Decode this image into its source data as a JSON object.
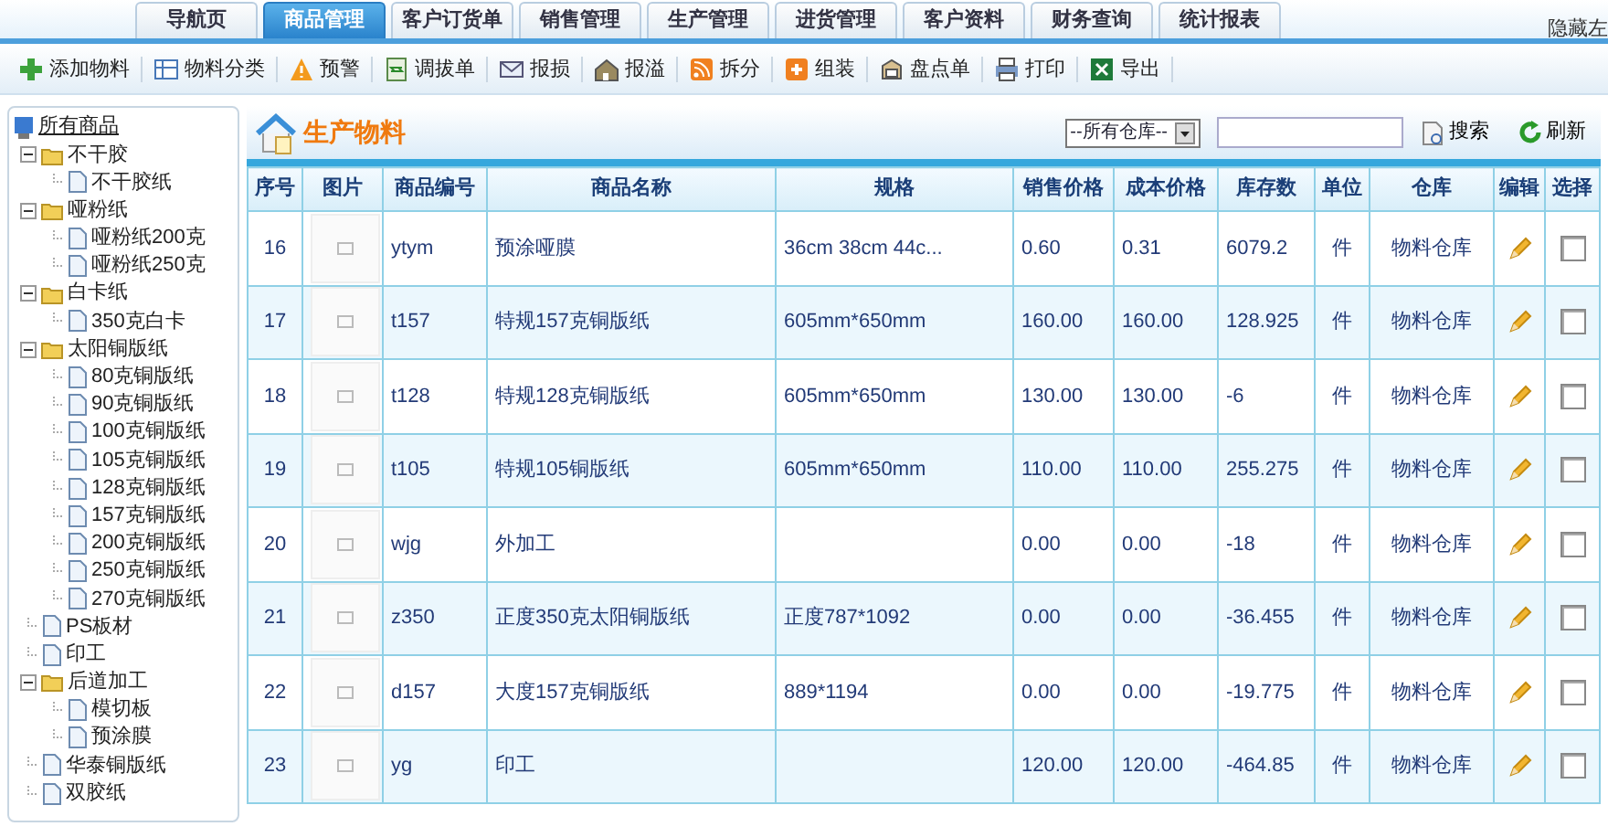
{
  "top_tabs": [
    {
      "label": "导航页",
      "selected": false
    },
    {
      "label": "商品管理",
      "selected": true
    },
    {
      "label": "客户订货单",
      "selected": false
    },
    {
      "label": "销售管理",
      "selected": false
    },
    {
      "label": "生产管理",
      "selected": false
    },
    {
      "label": "进货管理",
      "selected": false
    },
    {
      "label": "客户资料",
      "selected": false
    },
    {
      "label": "财务查询",
      "selected": false
    },
    {
      "label": "统计报表",
      "selected": false
    }
  ],
  "hide_left": "隐藏左",
  "toolbar": [
    "添加物料",
    "物料分类",
    "预警",
    "调拔单",
    "报损",
    "报溢",
    "拆分",
    "组装",
    "盘点单",
    "打印",
    "导出"
  ],
  "tree": {
    "root": "所有商品",
    "items": [
      {
        "label": "不干胶",
        "kind": "folder",
        "expanded": true,
        "children": [
          {
            "label": "不干胶纸",
            "kind": "leaf"
          }
        ]
      },
      {
        "label": "哑粉纸",
        "kind": "folder",
        "expanded": true,
        "children": [
          {
            "label": "哑粉纸200克",
            "kind": "leaf"
          },
          {
            "label": "哑粉纸250克",
            "kind": "leaf"
          }
        ]
      },
      {
        "label": "白卡纸",
        "kind": "folder",
        "expanded": true,
        "children": [
          {
            "label": "350克白卡",
            "kind": "leaf"
          }
        ]
      },
      {
        "label": "太阳铜版纸",
        "kind": "folder",
        "expanded": true,
        "children": [
          {
            "label": "80克铜版纸",
            "kind": "leaf"
          },
          {
            "label": "90克铜版纸",
            "kind": "leaf"
          },
          {
            "label": "100克铜版纸",
            "kind": "leaf"
          },
          {
            "label": "105克铜版纸",
            "kind": "leaf"
          },
          {
            "label": "128克铜版纸",
            "kind": "leaf"
          },
          {
            "label": "157克铜版纸",
            "kind": "leaf"
          },
          {
            "label": "200克铜版纸",
            "kind": "leaf"
          },
          {
            "label": "250克铜版纸",
            "kind": "leaf"
          },
          {
            "label": "270克铜版纸",
            "kind": "leaf"
          }
        ]
      },
      {
        "label": "PS板材",
        "kind": "leaf"
      },
      {
        "label": "印工",
        "kind": "leaf"
      },
      {
        "label": "后道加工",
        "kind": "folder",
        "expanded": true,
        "children": [
          {
            "label": "模切板",
            "kind": "leaf"
          },
          {
            "label": "预涂膜",
            "kind": "leaf"
          }
        ]
      },
      {
        "label": "华泰铜版纸",
        "kind": "leaf"
      },
      {
        "label": "双胶纸",
        "kind": "leaf"
      }
    ]
  },
  "panel": {
    "title": "生产物料",
    "warehouse_select": "--所有仓库--",
    "search_button": "搜索",
    "refresh_button": "刷新"
  },
  "table": {
    "columns": [
      "序号",
      "图片",
      "商品编号",
      "商品名称",
      "规格",
      "销售价格",
      "成本价格",
      "库存数",
      "单位",
      "仓库",
      "编辑",
      "选择"
    ],
    "rows": [
      {
        "no": "16",
        "code": "ytym",
        "name": "预涂哑膜",
        "spec": "36cm 38cm 44c...",
        "sale": "0.60",
        "cost": "0.31",
        "stock": "6079.2",
        "unit": "件",
        "warehouse": "物料仓库",
        "checked": false
      },
      {
        "no": "17",
        "code": "t157",
        "name": "特规157克铜版纸",
        "spec": "605mm*650mm",
        "sale": "160.00",
        "cost": "160.00",
        "stock": "128.925",
        "unit": "件",
        "warehouse": "物料仓库",
        "checked": false
      },
      {
        "no": "18",
        "code": "t128",
        "name": "特规128克铜版纸",
        "spec": "605mm*650mm",
        "sale": "130.00",
        "cost": "130.00",
        "stock": "-6",
        "unit": "件",
        "warehouse": "物料仓库",
        "checked": false
      },
      {
        "no": "19",
        "code": "t105",
        "name": "特规105铜版纸",
        "spec": "605mm*650mm",
        "sale": "110.00",
        "cost": "110.00",
        "stock": "255.275",
        "unit": "件",
        "warehouse": "物料仓库",
        "checked": false
      },
      {
        "no": "20",
        "code": "wjg",
        "name": "外加工",
        "spec": "",
        "sale": "0.00",
        "cost": "0.00",
        "stock": "-18",
        "unit": "件",
        "warehouse": "物料仓库",
        "checked": false
      },
      {
        "no": "21",
        "code": "z350",
        "name": "正度350克太阳铜版纸",
        "spec": "正度787*1092",
        "sale": "0.00",
        "cost": "0.00",
        "stock": "-36.455",
        "unit": "件",
        "warehouse": "物料仓库",
        "checked": false
      },
      {
        "no": "22",
        "code": "d157",
        "name": "大度157克铜版纸",
        "spec": "889*1194",
        "sale": "0.00",
        "cost": "0.00",
        "stock": "-19.775",
        "unit": "件",
        "warehouse": "物料仓库",
        "checked": false
      },
      {
        "no": "23",
        "code": "yg",
        "name": "印工",
        "spec": "",
        "sale": "120.00",
        "cost": "120.00",
        "stock": "-464.85",
        "unit": "件",
        "warehouse": "物料仓库",
        "checked": false
      }
    ]
  }
}
